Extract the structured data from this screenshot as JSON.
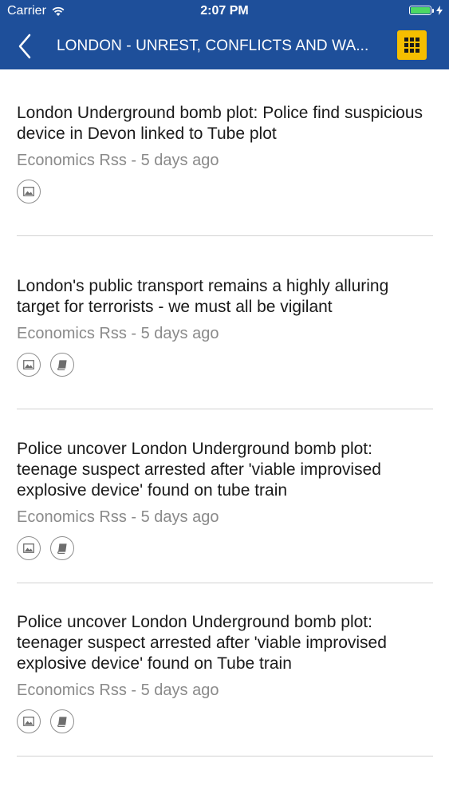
{
  "status_bar": {
    "carrier": "Carrier",
    "time": "2:07 PM",
    "battery_level": 1.0,
    "battery_color": "#4cd964"
  },
  "nav": {
    "back_icon": "chevron-left-icon",
    "title": "LONDON  - UNREST, CONFLICTS AND WA...",
    "menu_icon": "grid-icon",
    "bar_color": "#1e4f9a",
    "menu_color": "#f5be00"
  },
  "articles": [
    {
      "title": "London Underground bomb plot: Police find suspicious device in Devon linked to Tube plot",
      "meta": "Economics Rss - 5 days ago",
      "icons": [
        "image-icon"
      ]
    },
    {
      "title": "London's public transport remains a highly alluring target for terrorists - we must all be vigilant",
      "meta": "Economics Rss - 5 days ago",
      "icons": [
        "image-icon",
        "book-icon"
      ]
    },
    {
      "title": "Police uncover London Underground bomb plot: teenage suspect arrested after 'viable improvised explosive device' found on tube train",
      "meta": "Economics Rss - 5 days ago",
      "icons": [
        "image-icon",
        "book-icon"
      ]
    },
    {
      "title": "Police uncover London Underground bomb plot: teenager suspect arrested after 'viable improvised explosive device' found on Tube train",
      "meta": "Economics Rss - 5 days ago",
      "icons": [
        "image-icon",
        "book-icon"
      ]
    }
  ]
}
